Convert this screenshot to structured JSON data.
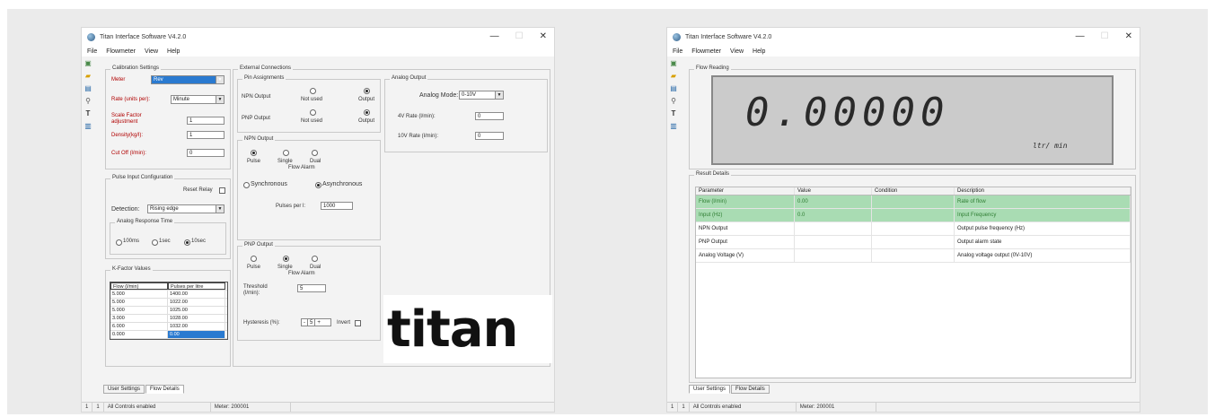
{
  "window": {
    "title": "Titan Interface Software V4.2.0",
    "controls": {
      "minimize": "—",
      "maximize": "☐",
      "close": "✕"
    }
  },
  "menu": [
    "File",
    "Flowmeter",
    "View",
    "Help"
  ],
  "toolbar_icons": [
    "chip-icon",
    "open-folder-icon",
    "save-icon",
    "search-icon",
    "text-icon",
    "page-icon"
  ],
  "left": {
    "calibration": {
      "title": "Calibration Settings",
      "meter_label": "Meter",
      "meter_value": "Rev",
      "rate_label": "Rate (units per):",
      "rate_value": "Minute",
      "scale_label_1": "Scale Factor",
      "scale_label_2": "adjustment",
      "scale_value": "1",
      "density_label": "Density(kg/l):",
      "density_value": "1",
      "cutoff_label": "Cut Off (l/min):",
      "cutoff_value": "0"
    },
    "pulse": {
      "title": "Pulse Input Configuration",
      "reset_label": "Reset Relay",
      "detection_label": "Detection:",
      "detection_value": "Rising edge",
      "response_title": "Analog Response Time",
      "r1": "100ms",
      "r2": "1sec",
      "r3": "10sec"
    },
    "kfactor": {
      "title": "K-Factor Values",
      "headers": [
        "Flow (l/min)",
        "Pulses per litre"
      ],
      "rows": [
        [
          "5.000",
          "1400.00"
        ],
        [
          "5.000",
          "1022.00"
        ],
        [
          "5.000",
          "1025.00"
        ],
        [
          "3.000",
          "1028.00"
        ],
        [
          "6.000",
          "1032.00"
        ],
        [
          "0.000",
          "0.00"
        ]
      ]
    },
    "external": {
      "title": "External Connections",
      "pin_title": "Pin Assignments",
      "npn_label": "NPN Output",
      "pnp_label": "PNP Output",
      "not_used": "Not used",
      "output": "Output"
    },
    "npn_out": {
      "title": "NPN Output",
      "pulse": "Pulse",
      "single": "Single",
      "dual": "Dual",
      "flow_alarm": "Flow Alarm",
      "synchronous": "Synchronous",
      "asynchronous": "Asynchronous",
      "pulses_label": "Pulses per l:",
      "pulses_value": "1000"
    },
    "pnp_out": {
      "title": "PNP Output",
      "pulse": "Pulse",
      "single": "Single",
      "dual": "Dual",
      "flow_alarm": "Flow Alarm",
      "threshold_label_1": "Threshold",
      "threshold_label_2": "(l/min):",
      "threshold_value": "5",
      "hysteresis_label": "Hysteresis (%):",
      "hysteresis_value": "5",
      "invert_label": "Invert"
    },
    "analog": {
      "title": "Analog Output",
      "mode_label": "Analog Mode:",
      "mode_value": "0-10V",
      "ma_label": "4V Rate (l/min):",
      "ma_value": "0",
      "v_label": "10V Rate (l/min):",
      "v_value": "0"
    },
    "logo": "titan",
    "tabs": [
      "User Settings",
      "Flow Details"
    ],
    "status": [
      "1",
      "1",
      "All Controls enabled",
      "Meter: 200001"
    ]
  },
  "right": {
    "flow_reading_title": "Flow Reading",
    "lcd_value": "0.00000",
    "lcd_unit": "ltr/ min",
    "result_title": "Result Details",
    "headers": [
      "Parameter",
      "Value",
      "Condition",
      "Description"
    ],
    "rows": [
      [
        "Flow (l/min)",
        "0.00",
        "",
        "Rate of flow"
      ],
      [
        "Input (Hz)",
        "0.0",
        "",
        "Input Frequency"
      ],
      [
        "NPN Output",
        "",
        "",
        "Output pulse frequency (Hz)"
      ],
      [
        "PNP Output",
        "",
        "",
        "Output alarm state"
      ],
      [
        "Analog Voltage (V)",
        "",
        "",
        "Analog voltage output (0V-10V)"
      ]
    ],
    "tabs": [
      "User Settings",
      "Flow Details"
    ],
    "status": [
      "1",
      "1",
      "All Controls enabled",
      "Meter: 200001"
    ]
  }
}
